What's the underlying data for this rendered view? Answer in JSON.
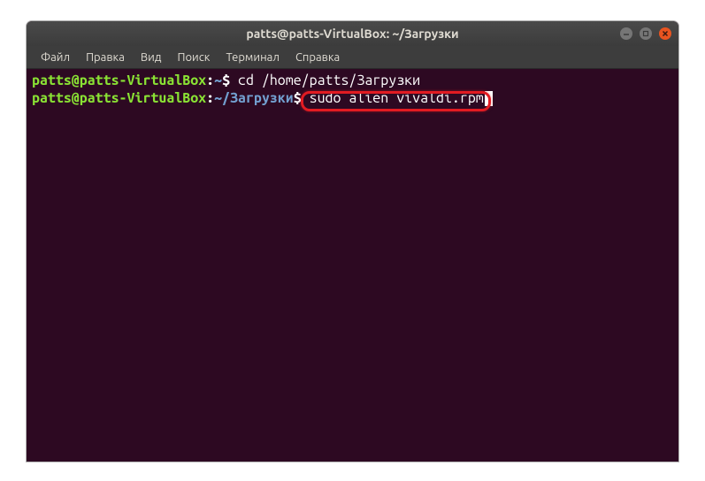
{
  "window": {
    "title": "patts@patts-VirtualBox: ~/Загрузки"
  },
  "menubar": {
    "items": [
      "Файл",
      "Правка",
      "Вид",
      "Поиск",
      "Терминал",
      "Справка"
    ]
  },
  "terminal": {
    "lines": [
      {
        "user": "patts@patts-VirtualBox",
        "colon": ":",
        "path": "~",
        "dollar": "$",
        "command": " cd /home/patts/Загрузки"
      },
      {
        "user": "patts@patts-VirtualBox",
        "colon": ":",
        "path": "~/Загрузки",
        "dollar": "$",
        "command": " sudo alien vivaldi.rpm"
      }
    ]
  },
  "highlight": {
    "target": "sudo alien vivaldi.rpm"
  }
}
